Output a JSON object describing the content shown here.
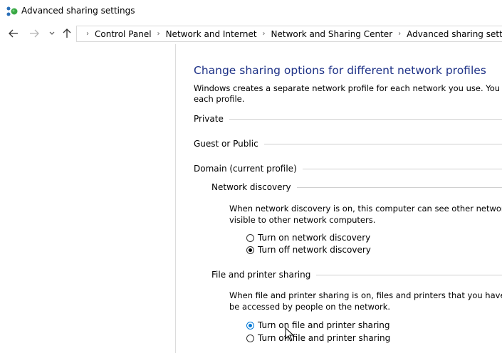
{
  "window": {
    "title": "Advanced sharing settings"
  },
  "address_bar": {
    "crumbs": [
      "Control Panel",
      "Network and Internet",
      "Network and Sharing Center",
      "Advanced sharing settings"
    ]
  },
  "main": {
    "heading": "Change sharing options for different network profiles",
    "desc_line1": "Windows creates a separate network profile for each network you use. You can cho",
    "desc_line2": "each profile.",
    "profiles": {
      "private": "Private",
      "guest": "Guest or Public",
      "domain": "Domain (current profile)"
    },
    "network_discovery": {
      "title": "Network discovery",
      "para1": "When network discovery is on, this computer can see other network com",
      "para2": "visible to other network computers.",
      "opt_on": "Turn on network discovery",
      "opt_off": "Turn off network discovery",
      "selected": "off"
    },
    "file_printer": {
      "title": "File and printer sharing",
      "para1": "When file and printer sharing is on, files and printers that you have shared",
      "para2": "be accessed by people on the network.",
      "opt_on": "Turn on file and printer sharing",
      "opt_off": "Turn off file and printer sharing",
      "selected": "on"
    }
  },
  "colors": {
    "heading": "#1e3287",
    "focus": "#0078d7"
  }
}
